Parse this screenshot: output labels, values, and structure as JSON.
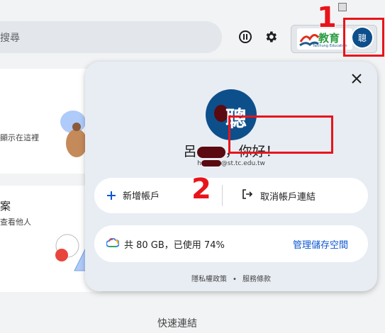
{
  "toolbar": {
    "search_placeholder": "搜尋",
    "extension_logo_text": "教育",
    "extension_logo_sub": "Taichung Education",
    "profile_avatar_text": "聰"
  },
  "annotations": {
    "marker_1": "1",
    "marker_2": "2"
  },
  "background_cards": {
    "card1_text": "顯示在這裡",
    "card2_heading": "案",
    "card2_text": "查看他人"
  },
  "quick_links": "快速連結",
  "account_popup": {
    "avatar_text": "聰",
    "greeting_prefix": "呂",
    "greeting_suffix": "，你好！",
    "email_prefix": "h",
    "email_suffix": "@st.tc.edu.tw",
    "add_account_label": "新增帳戶",
    "unlink_account_label": "取消帳戶連結",
    "storage_text": "共 80 GB，已使用 74%",
    "manage_storage_label": "管理儲存空間",
    "privacy_policy_label": "隱私權政策",
    "footer_separator": "•",
    "terms_label": "服務條款"
  }
}
